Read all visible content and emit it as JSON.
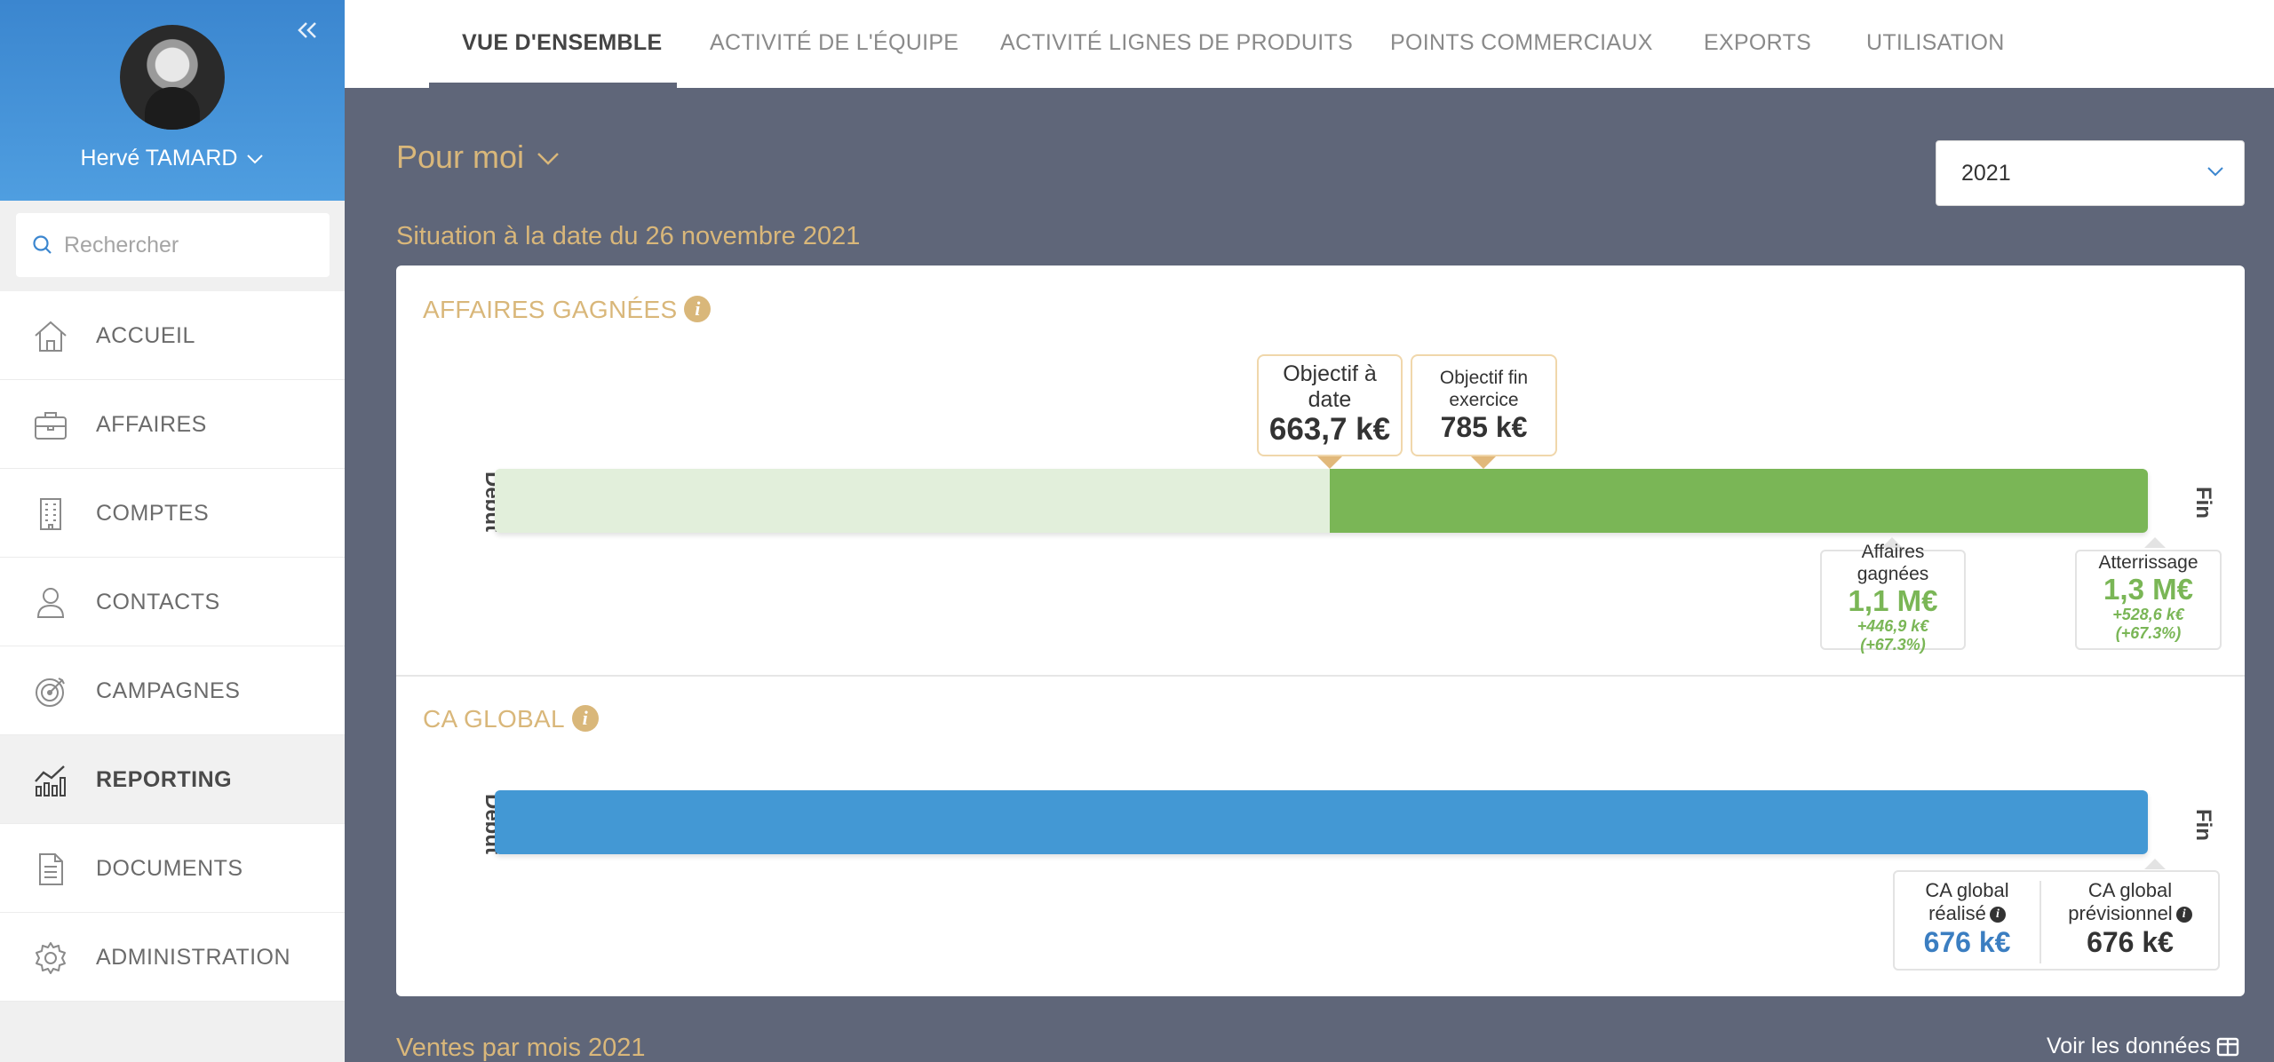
{
  "user": {
    "name": "Hervé TAMARD"
  },
  "search": {
    "placeholder": "Rechercher"
  },
  "nav": [
    {
      "label": "ACCUEIL",
      "icon": "home-icon"
    },
    {
      "label": "AFFAIRES",
      "icon": "briefcase-icon"
    },
    {
      "label": "COMPTES",
      "icon": "building-icon"
    },
    {
      "label": "CONTACTS",
      "icon": "person-icon"
    },
    {
      "label": "CAMPAGNES",
      "icon": "target-icon"
    },
    {
      "label": "REPORTING",
      "icon": "chart-icon",
      "active": true
    },
    {
      "label": "DOCUMENTS",
      "icon": "document-icon"
    },
    {
      "label": "ADMINISTRATION",
      "icon": "gear-icon"
    }
  ],
  "tabs": [
    {
      "label": "VUE D'ENSEMBLE",
      "active": true
    },
    {
      "label": "ACTIVITÉ DE L'ÉQUIPE"
    },
    {
      "label": "ACTIVITÉ LIGNES DE PRODUITS"
    },
    {
      "label": "POINTS COMMERCIAUX"
    },
    {
      "label": "EXPORTS"
    },
    {
      "label": "UTILISATION"
    }
  ],
  "scope": {
    "label": "Pour moi"
  },
  "year": {
    "value": "2021"
  },
  "situation": "Situation à la date du 26 novembre 2021",
  "affaires": {
    "title": "AFFAIRES GAGNÉES",
    "start_label": "Début",
    "end_label": "Fin",
    "objectif_date": {
      "line1": "Objectif à",
      "line2": "date",
      "value": "663,7 k€"
    },
    "objectif_fin": {
      "line1": "Objectif fin",
      "line2": "exercice",
      "value": "785 k€"
    },
    "gagnees": {
      "line1": "Affaires",
      "line2": "gagnées",
      "value": "1,1 M€",
      "delta": "+446,9 k€",
      "pct": "(+67.3%)"
    },
    "atterrissage": {
      "label": "Atterrissage",
      "value": "1,3 M€",
      "delta": "+528,6 k€",
      "pct": "(+67.3%)"
    },
    "progress": {
      "objectif_date_fraction": 0.505,
      "objectif_fin_fraction": 0.598
    }
  },
  "ca": {
    "title": "CA GLOBAL",
    "start_label": "Début",
    "end_label": "Fin",
    "realise": {
      "line1": "CA global",
      "line2": "réalisé",
      "value": "676 k€"
    },
    "previsionnel": {
      "line1": "CA global",
      "line2": "prévisionnel",
      "value": "676 k€"
    }
  },
  "footer": {
    "left": "Ventes par mois 2021",
    "right": "Voir les données"
  },
  "colors": {
    "accent": "#d9b77a",
    "green": "#7ab656",
    "light_green": "#e2efdb",
    "blue": "#4398d4",
    "background": "#5f6679",
    "sidebar_head": "#4a95da"
  }
}
